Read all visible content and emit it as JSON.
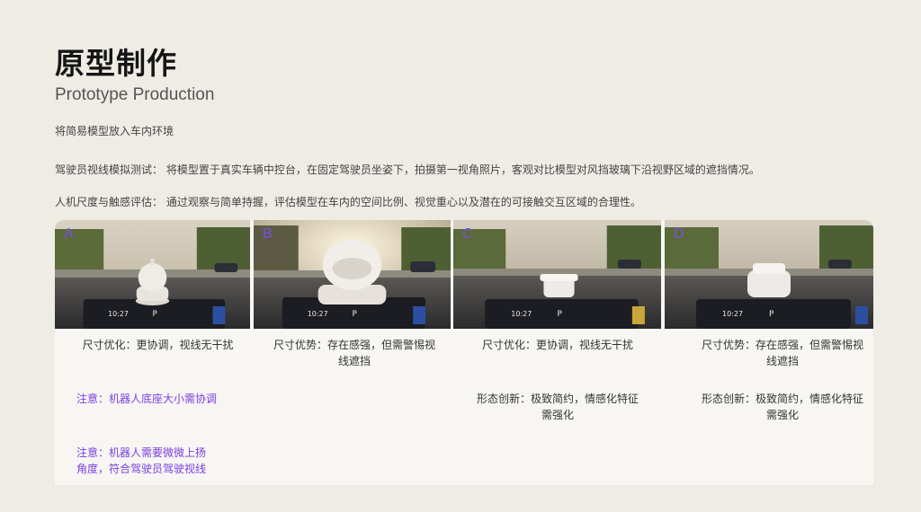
{
  "header": {
    "title": "原型制作",
    "subtitle": "Prototype Production"
  },
  "intro": {
    "line1": "将简易模型放入车内环境",
    "line2": "驾驶员视线模拟测试： 将模型置于真实车辆中控台，在固定驾驶员坐姿下，拍摄第一视角照片，客观对比模型对风挡玻璃下沿视野区域的遮挡情况。",
    "line3": "人机尺度与触感评估： 通过观察与简单持握，评估模型在车内的空间比例、视觉重心以及潜在的可接触交互区域的合理性。"
  },
  "cards": [
    {
      "letter": "A",
      "dash_time": "10:27",
      "dash_gear": "P",
      "caption1": "尺寸优化：更协调，视线无干扰",
      "note1": "注意：机器人底座大小需协调",
      "note2": "注意：机器人需要微微上扬角度，符合驾驶员驾驶视线"
    },
    {
      "letter": "B",
      "dash_time": "10:27",
      "dash_gear": "P",
      "caption1": "尺寸优势：存在感强，但需警惕视线遮挡"
    },
    {
      "letter": "C",
      "dash_time": "10:27",
      "dash_gear": "P",
      "caption1": "尺寸优化：更协调，视线无干扰",
      "caption2": "形态创新：极致简约，情感化特征需强化"
    },
    {
      "letter": "D",
      "dash_time": "10:27",
      "dash_gear": "P",
      "caption1": "尺寸优势：存在感强，但需警惕视线遮挡",
      "caption2": "形态创新：极致简约，情感化特征需强化"
    }
  ],
  "colors": {
    "background": "#efece6",
    "panel": "#f7f6f3",
    "accent": "#7b3fe0"
  }
}
